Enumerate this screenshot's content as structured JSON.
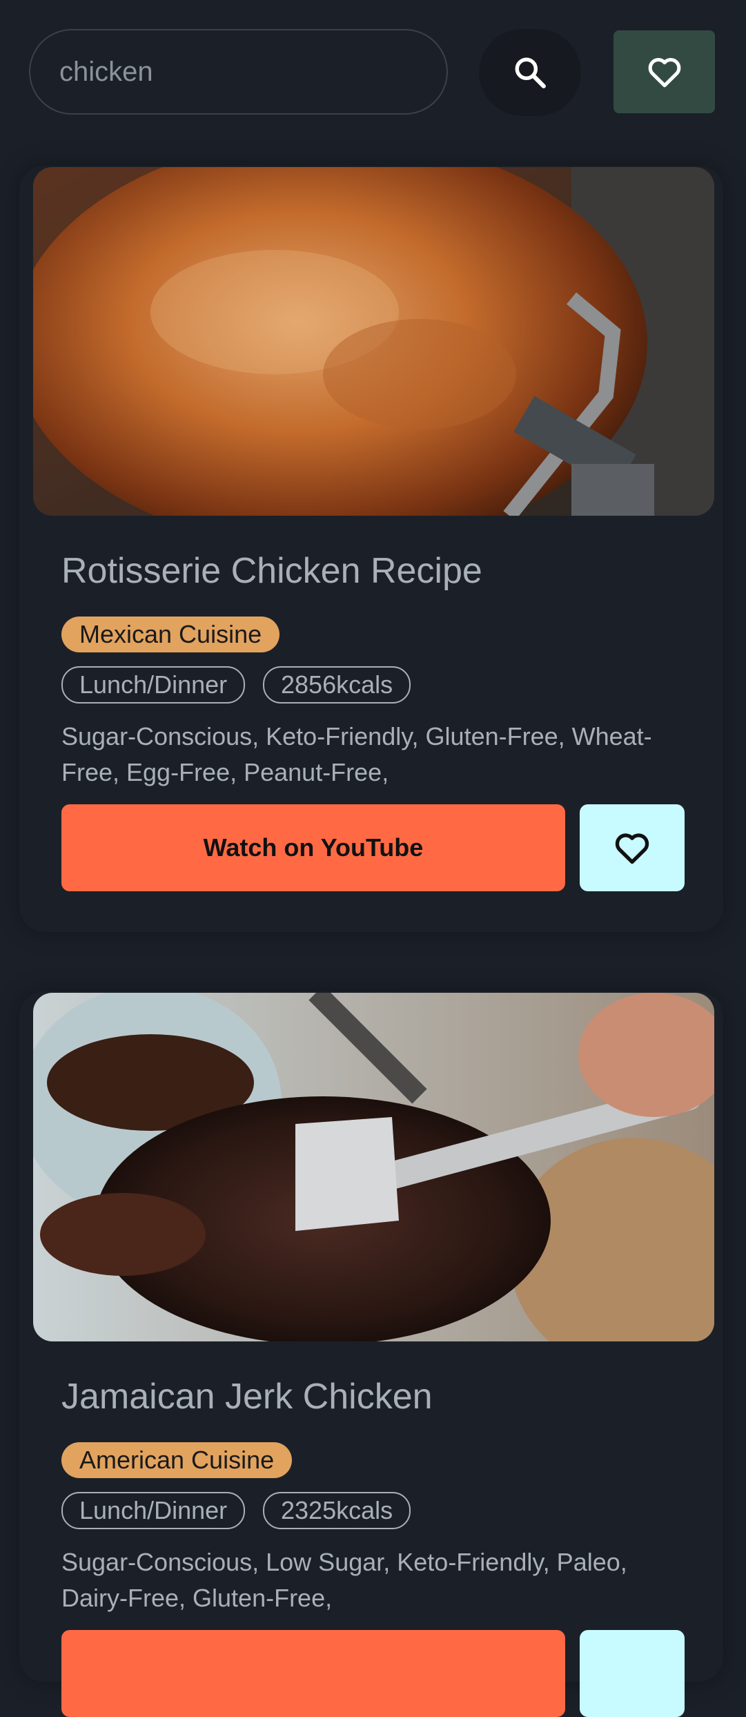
{
  "search": {
    "value": "chicken"
  },
  "recipes": [
    {
      "title": "Rotisserie Chicken Recipe",
      "cuisine": "Mexican Cuisine",
      "meal_type": "Lunch/Dinner",
      "calories": "2856kcals",
      "health_labels": "Sugar-Conscious, Keto-Friendly, Gluten-Free, Wheat-Free, Egg-Free, Peanut-Free,",
      "youtube_label": "Watch on YouTube"
    },
    {
      "title": "Jamaican Jerk Chicken",
      "cuisine": "American Cuisine",
      "meal_type": "Lunch/Dinner",
      "calories": "2325kcals",
      "health_labels": "Sugar-Conscious, Low Sugar, Keto-Friendly, Paleo, Dairy-Free, Gluten-Free,",
      "youtube_label": ""
    }
  ],
  "colors": {
    "background": "#1b2028",
    "youtube_button": "#ff6a45",
    "favorite_button": "#c8fbff",
    "cuisine_badge": "#e2a35f",
    "favorites_nav": "#334a43"
  },
  "icons": [
    "search-icon",
    "heart-icon"
  ]
}
